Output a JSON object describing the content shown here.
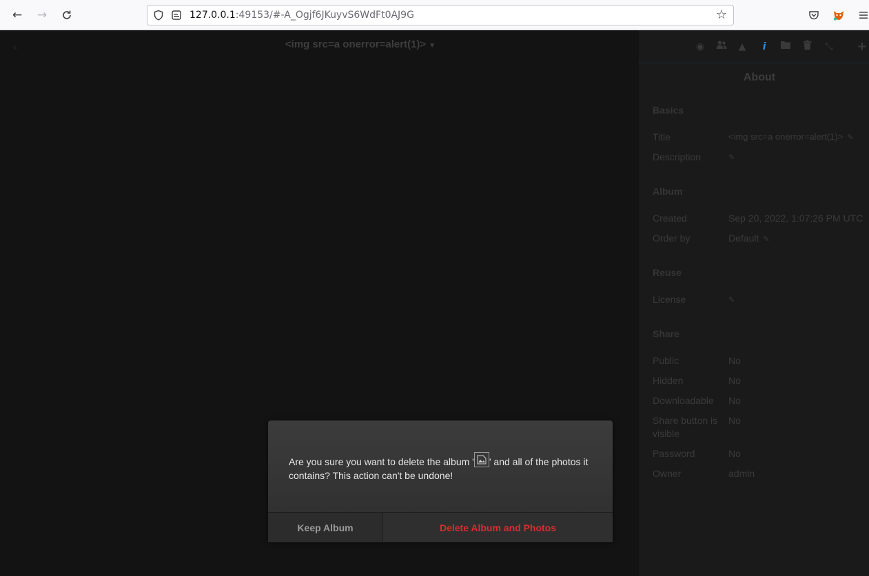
{
  "browser": {
    "url_host": "127.0.0.1",
    "url_rest": ":49153/#-A_Ogjf6JKuyvS6WdFt0AJ9G"
  },
  "header": {
    "album_title": "<img src=a onerror=alert(1)>"
  },
  "sidebar": {
    "heading": "About",
    "basics": {
      "label": "Basics",
      "title_key": "Title",
      "title_value": "<img src=a onerror=alert(1)>",
      "description_key": "Description"
    },
    "album": {
      "label": "Album",
      "created_key": "Created",
      "created_value": "Sep 20, 2022, 1:07:26 PM UTC",
      "order_key": "Order by",
      "order_value": "Default"
    },
    "reuse": {
      "label": "Reuse",
      "license_key": "License"
    },
    "share": {
      "label": "Share",
      "public_key": "Public",
      "public_value": "No",
      "hidden_key": "Hidden",
      "hidden_value": "No",
      "downloadable_key": "Downloadable",
      "downloadable_value": "No",
      "share_button_key": "Share button is visible",
      "share_button_value": "No",
      "password_key": "Password",
      "password_value": "No",
      "owner_key": "Owner",
      "owner_value": "admin"
    }
  },
  "dialog": {
    "message_before": "Are you sure you want to delete the album '",
    "message_after": "' and all of the photos it contains? This action can't be undone!",
    "keep_label": "Keep Album",
    "delete_label": "Delete Album and Photos"
  },
  "icons": {
    "back": "arrow-left-icon",
    "forward": "arrow-right-icon",
    "reload": "reload-icon",
    "shield": "shield-icon",
    "info": "info-icon",
    "star": "star-icon",
    "pocket": "pocket-icon",
    "extension": "fox-extension-icon",
    "menu": "hamburger-menu-icon"
  },
  "colors": {
    "danger": "#d92c34",
    "accent": "#2293ec"
  }
}
